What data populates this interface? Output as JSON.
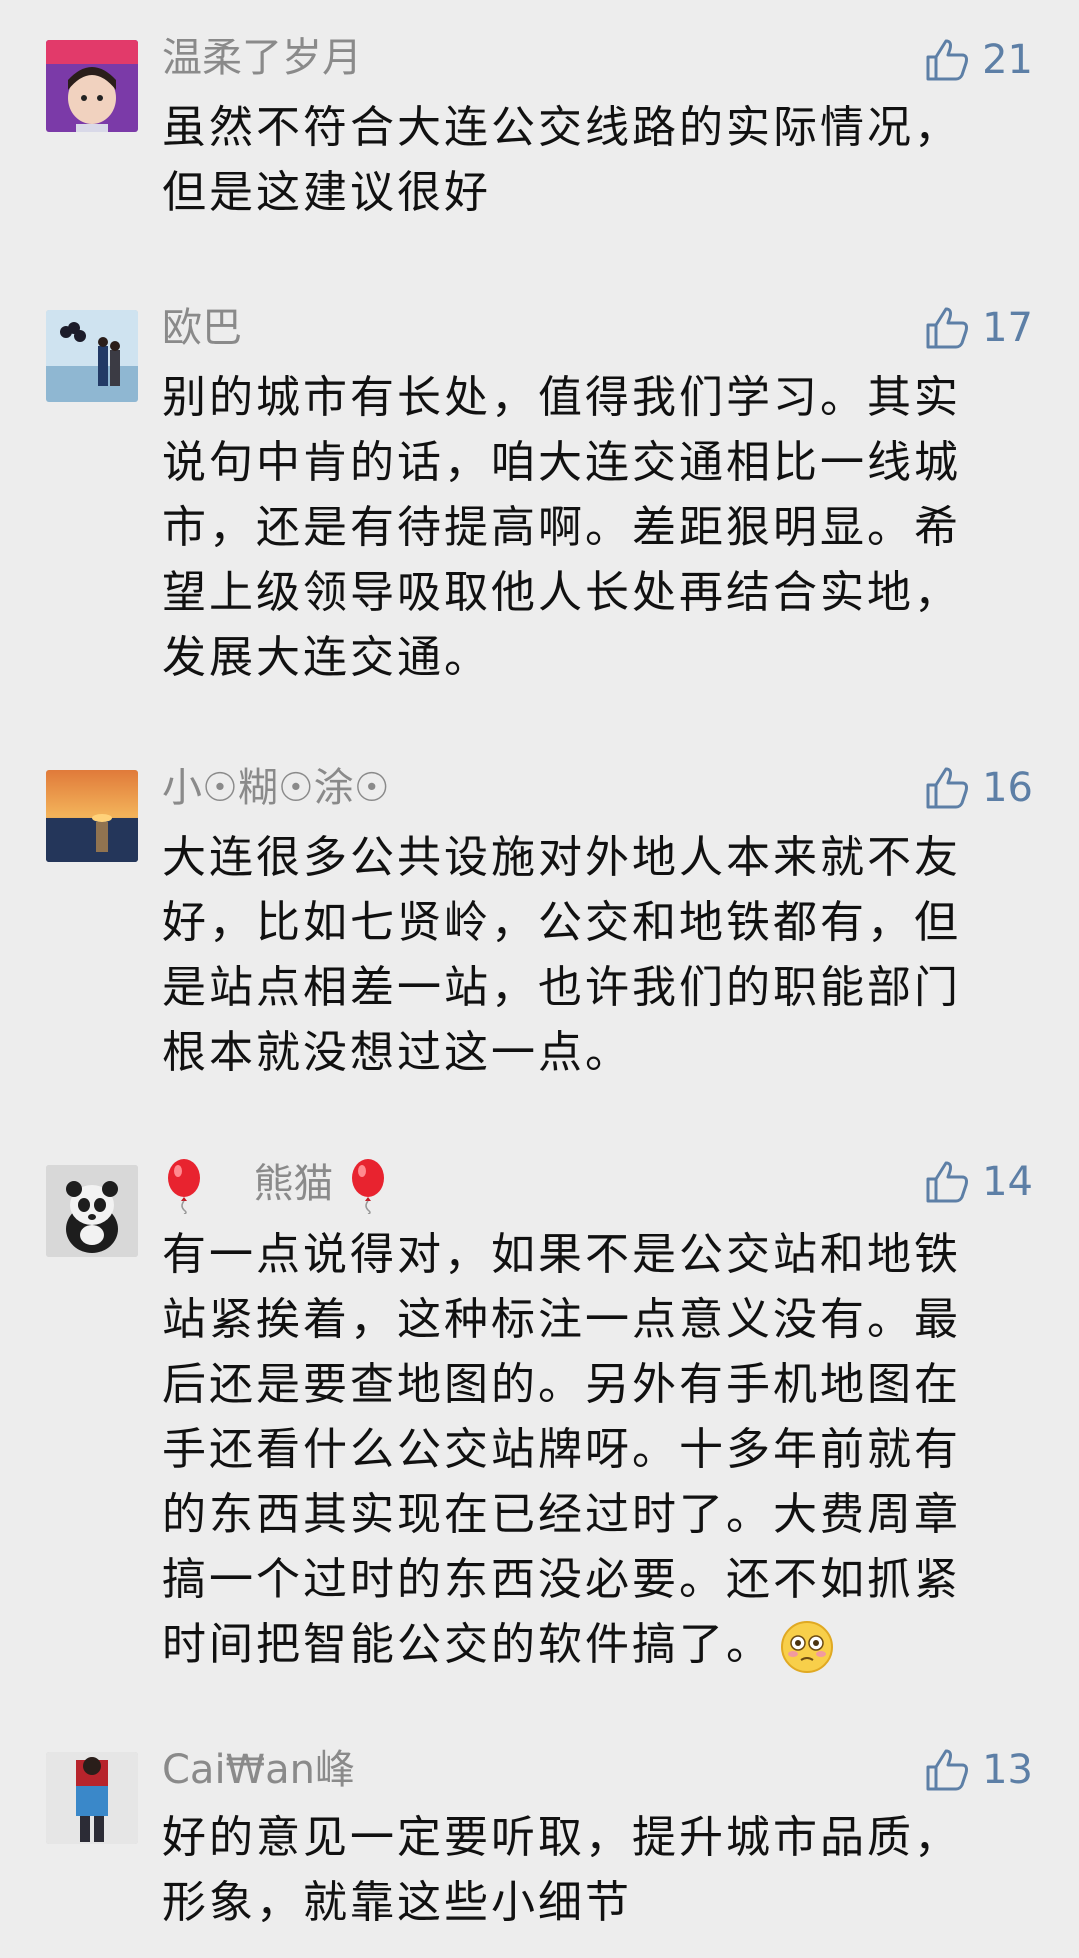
{
  "comments": [
    {
      "user": "温柔了岁月",
      "likes": "21",
      "lines": [
        "虽然不符合大连公交线路的实际情况，",
        "但是这建议很好"
      ]
    },
    {
      "user": "欧巴",
      "likes": "17",
      "lines": [
        "别的城市有长处，值得我们学习。其实",
        "说句中肯的话，咱大连交通相比一线城",
        "市，还是有待提高啊。差距狠明显。希",
        "望上级领导吸取他人长处再结合实地，",
        "发展大连交通。"
      ]
    },
    {
      "user": "小☉糊☉涂☉",
      "likes": "16",
      "lines": [
        "大连很多公共设施对外地人本来就不友",
        "好，比如七贤岭，公交和地铁都有，但",
        "是站点相差一站，也许我们的职能部门",
        "根本就没想过这一点。"
      ]
    },
    {
      "user": "熊猫",
      "likes": "14",
      "lines": [
        "有一点说得对，如果不是公交站和地铁",
        "站紧挨着，这种标注一点意义没有。最",
        "后还是要查地图的。另外有手机地图在",
        "手还看什么公交站牌呀。十多年前就有",
        "的东西其实现在已经过时了。大费周章",
        "搞一个过时的东西没必要。还不如抓紧",
        "时间把智能公交的软件搞了。"
      ]
    },
    {
      "user": "Cai₩an峰",
      "likes": "13",
      "lines": [
        "好的意见一定要听取，提升城市品质，",
        "形象，就靠这些小细节"
      ]
    }
  ],
  "icons": {
    "like": "thumbs-up-icon",
    "balloon": "red-balloon-emoji",
    "emoji": "flushed-face-emoji"
  },
  "colors": {
    "background": "#ededed",
    "nickname": "#8a8a8a",
    "like": "#5d7fa6",
    "text": "#111111"
  }
}
